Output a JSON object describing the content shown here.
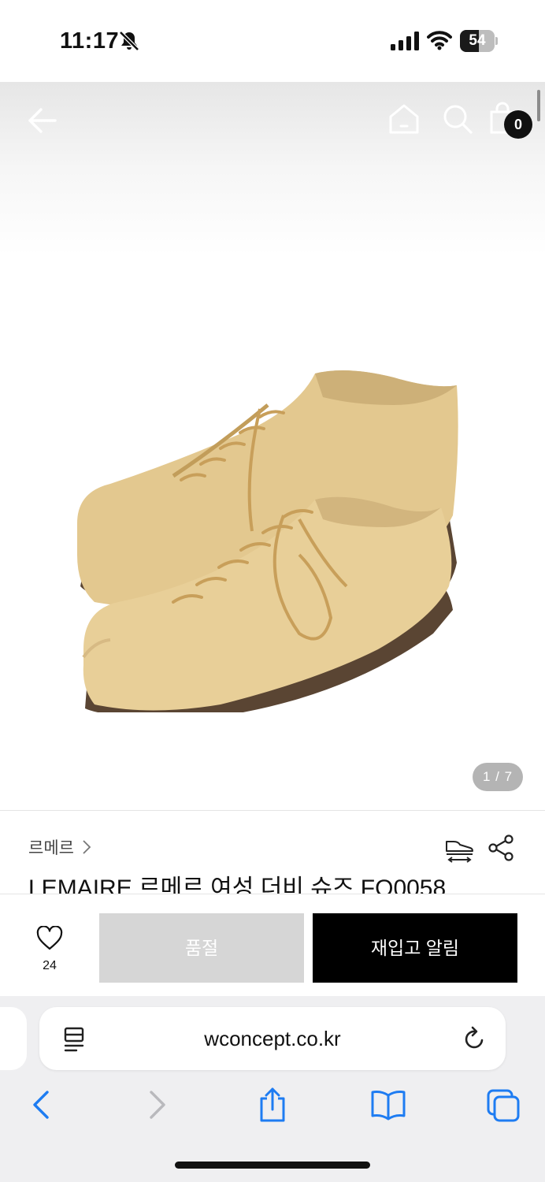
{
  "status_bar": {
    "time": "11:17",
    "battery_level": "54",
    "battery_fraction": 0.54
  },
  "product": {
    "image_indicator": "1 / 7",
    "brand": "르메르",
    "title": "LEMAIRE 르메르 여성 더비 슈즈 FO0058",
    "cart_count": "0",
    "image_description_colors": {
      "leather": "#e3c88f",
      "sole": "#5a4533"
    }
  },
  "icons": {
    "back": "arrow-left-icon",
    "home": "home-icon",
    "search": "search-icon",
    "cart": "shopping-bag-icon",
    "size_guide": "shoe-size-icon",
    "share": "share-icon",
    "wishlist": "heart-icon"
  },
  "actions": {
    "wish_count": "24",
    "soldout_label": "품절",
    "restock_label": "재입고 알림"
  },
  "browser": {
    "url": "wconcept.co.kr"
  }
}
